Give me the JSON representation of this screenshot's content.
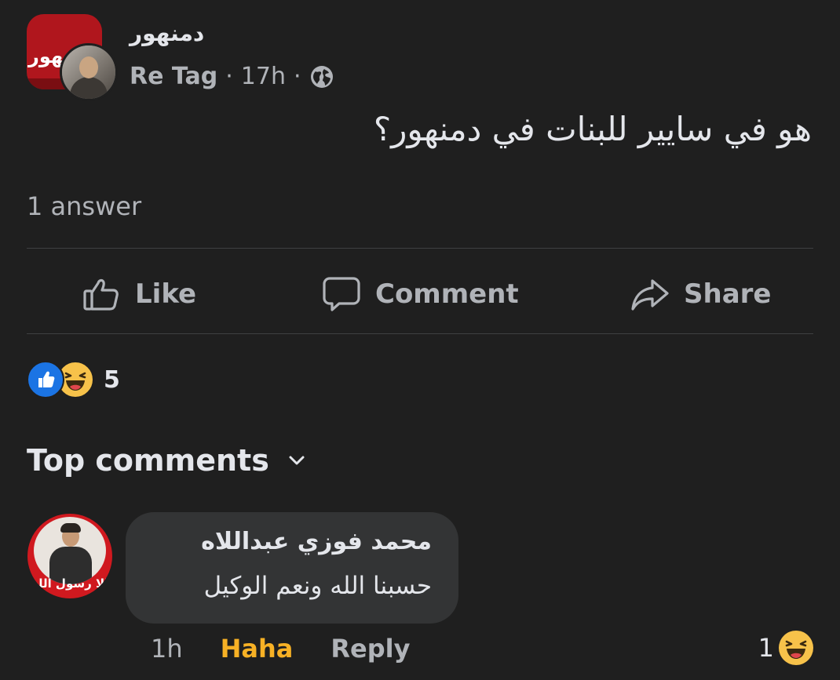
{
  "post": {
    "group_name": "دمنهور",
    "group_logo_text": "دمنهور",
    "author": "Re Tag",
    "time": "17h",
    "separator": "·",
    "text": "هو في سايير للبنات في دمنهور؟",
    "answers": "1 answer"
  },
  "actions": {
    "like": "Like",
    "comment": "Comment",
    "share": "Share"
  },
  "reactions": {
    "count": "5",
    "types": [
      "like-icon",
      "haha-icon"
    ]
  },
  "comments_section": {
    "title": "Top comments"
  },
  "comment": {
    "author": "محمد فوزي عبداللاه",
    "text": "حسبنا الله ونعم الوكيل",
    "avatar_text": "الا رسول الله",
    "time": "1h",
    "reaction_label": "Haha",
    "reply_label": "Reply",
    "reaction_count": "1"
  },
  "colors": {
    "background": "#1f1f1f",
    "bubble": "#333435",
    "haha_accent": "#f7b125",
    "like_blue": "#1b74e4",
    "group_red": "#b0161d"
  }
}
